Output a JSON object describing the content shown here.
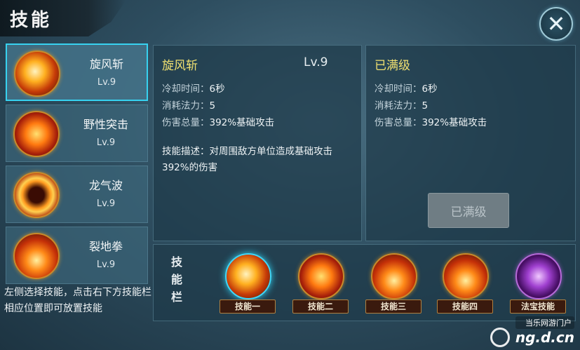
{
  "header": {
    "title": "技能",
    "close_icon": "close-x-icon"
  },
  "skills": [
    {
      "name": "旋风斩",
      "level": "Lv.9",
      "icon": "whirlwind-slash-icon",
      "selected": true
    },
    {
      "name": "野性突击",
      "level": "Lv.9",
      "icon": "wild-assault-icon"
    },
    {
      "name": "龙气波",
      "level": "Lv.9",
      "icon": "dragon-wave-icon"
    },
    {
      "name": "裂地拳",
      "level": "Lv.9",
      "icon": "earth-splitting-fist-icon"
    }
  ],
  "hint": "左侧选择技能，点击右下方技能栏相应位置即可放置技能",
  "current": {
    "name": "旋风斩",
    "level": "Lv.9",
    "cooldown_label": "冷却时间：",
    "cooldown": "6秒",
    "cost_label": "消耗法力：",
    "cost": "5",
    "damage_label": "伤害总量：",
    "damage": "392%基础攻击",
    "desc_label": "技能描述：",
    "desc": "对周围敌方单位造成基础攻击392%的伤害"
  },
  "next": {
    "title": "已满级",
    "cooldown_label": "冷却时间：",
    "cooldown": "6秒",
    "cost_label": "消耗法力：",
    "cost": "5",
    "damage_label": "伤害总量：",
    "damage": "392%基础攻击",
    "button": "已满级"
  },
  "skill_bar": {
    "title_lines": [
      "技",
      "能",
      "栏"
    ],
    "slots": [
      {
        "label": "技能一",
        "icon": "whirlwind-slash-icon",
        "active": true
      },
      {
        "label": "技能二",
        "icon": "wild-assault-icon"
      },
      {
        "label": "技能三",
        "icon": "blade-strike-icon"
      },
      {
        "label": "技能四",
        "icon": "earth-splitting-fist-icon"
      },
      {
        "label": "法宝技能",
        "icon": "treasure-skill-icon"
      }
    ]
  },
  "watermark": {
    "text": "当乐网游门户",
    "url": "ng.d.cn"
  },
  "colors": {
    "accent": "#37d2f0",
    "gold_text": "#f0e070",
    "panel_bg": "#1e3a4a"
  }
}
